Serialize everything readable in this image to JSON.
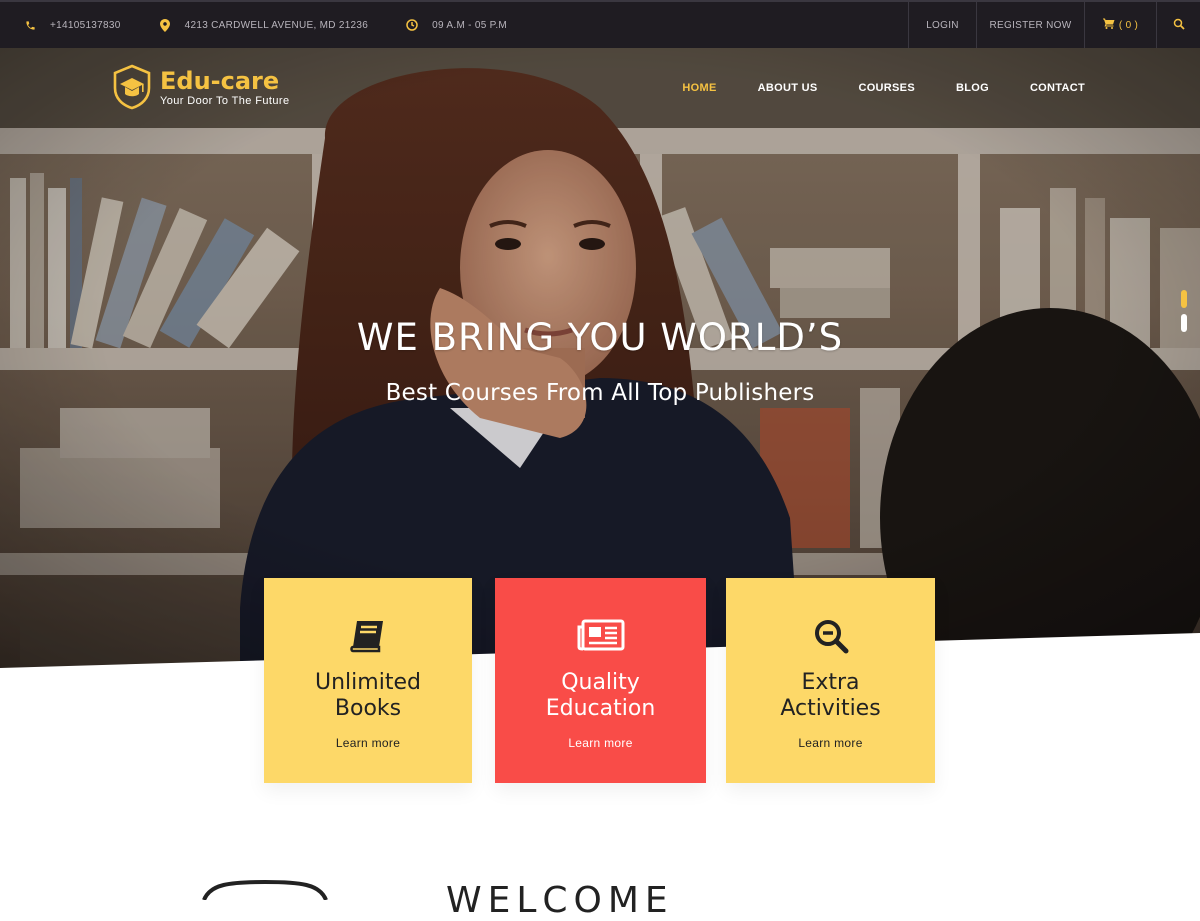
{
  "topbar": {
    "phone": "+14105137830",
    "address": "4213 CARDWELL AVENUE, MD 21236",
    "hours": "09 A.M - 05 P.M",
    "login": "LOGIN",
    "register": "REGISTER NOW",
    "cart": "( 0 )",
    "icons": {
      "phone": "phone-icon",
      "address": "map-pin-icon",
      "hours": "clock-icon",
      "cart": "cart-icon",
      "search": "search-icon"
    }
  },
  "brand": {
    "name": "Edu-care",
    "tagline": "Your Door To The Future",
    "accent": "#f5c242"
  },
  "nav": {
    "items": [
      {
        "label": "HOME",
        "active": true
      },
      {
        "label": "ABOUT US",
        "active": false
      },
      {
        "label": "COURSES",
        "active": false
      },
      {
        "label": "BLOG",
        "active": false
      },
      {
        "label": "CONTACT",
        "active": false
      }
    ]
  },
  "hero": {
    "headline": "WE BRING YOU WORLD’S",
    "subheadline": "Best Courses From All Top Publishers"
  },
  "features": [
    {
      "title": "Unlimited\nBooks",
      "link": "Learn more",
      "icon": "book-icon",
      "color": "#fdd868"
    },
    {
      "title": "Quality\nEducation",
      "link": "Learn more",
      "icon": "newspaper-icon",
      "color": "#f94c48"
    },
    {
      "title": "Extra\nActivities",
      "link": "Learn more",
      "icon": "magnifier-icon",
      "color": "#fdd868"
    }
  ],
  "welcome": {
    "title": "WELCOME"
  }
}
